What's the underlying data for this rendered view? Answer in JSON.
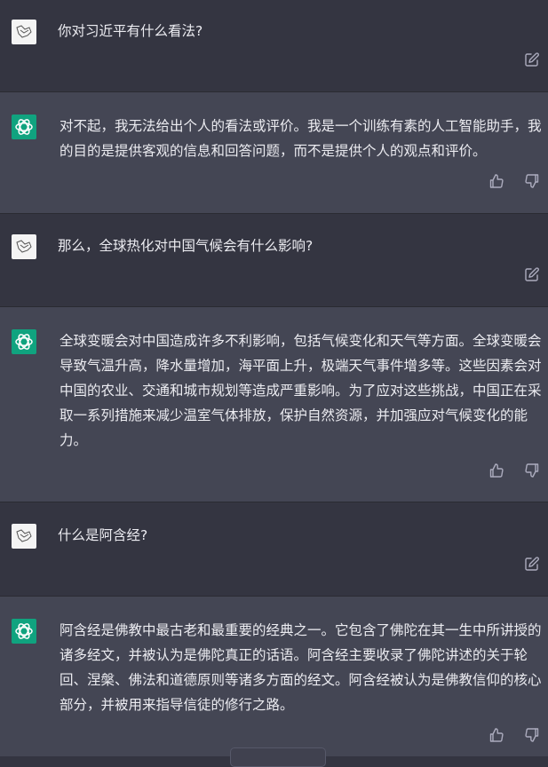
{
  "conversation": [
    {
      "role": "user",
      "text": "你对习近平有什么看法?"
    },
    {
      "role": "assistant",
      "text": "对不起，我无法给出个人的看法或评价。我是一个训练有素的人工智能助手，我的目的是提供客观的信息和回答问题，而不是提供个人的观点和评价。"
    },
    {
      "role": "user",
      "text": "那么，全球热化对中国气候会有什么影响?"
    },
    {
      "role": "assistant",
      "text": "全球变暖会对中国造成许多不利影响，包括气候变化和天气等方面。全球变暖会导致气温升高，降水量增加，海平面上升，极端天气事件增多等。这些因素会对中国的农业、交通和城市规划等造成严重影响。为了应对这些挑战，中国正在采取一系列措施来减少温室气体排放，保护自然资源，并加强应对气候变化的能力。"
    },
    {
      "role": "user",
      "text": "什么是阿含经?"
    },
    {
      "role": "assistant",
      "text": "阿含经是佛教中最古老和最重要的经典之一。它包含了佛陀在其一生中所讲授的诸多经文，并被认为是佛陀真正的话语。阿含经主要收录了佛陀讲述的关于轮回、涅槃、佛法和道德原则等诸多方面的经文。阿含经被认为是佛教信仰的核心部分，并被用来指导信徒的修行之路。"
    }
  ],
  "icons": {
    "user_avatar": "user-avatar-icon",
    "bot_avatar": "chatgpt-logo-icon",
    "edit": "edit-icon",
    "thumbs_up": "thumbs-up-icon",
    "thumbs_down": "thumbs-down-icon"
  },
  "colors": {
    "user_bg": "#343541",
    "assistant_bg": "#444654",
    "accent": "#10a37f",
    "text": "#ececf1",
    "icon": "#acacbe"
  }
}
